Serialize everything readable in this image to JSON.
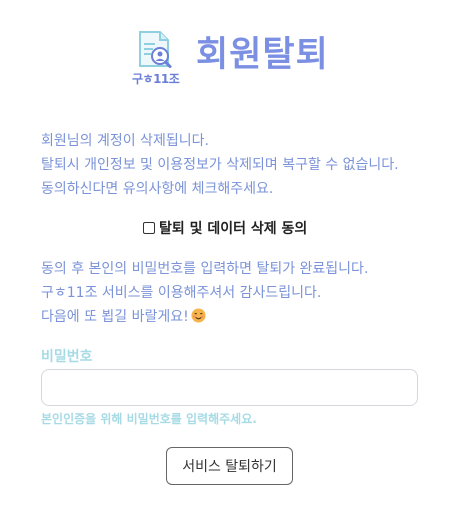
{
  "header": {
    "logo_text": "구ㅎ11조",
    "title": "회원탈퇴"
  },
  "notice_top": {
    "lines": [
      "회원님의 계정이 삭제됩니다.",
      "탈퇴시 개인정보 및 이용정보가 삭제되며 복구할 수 없습니다.",
      "동의하신다면 유의사항에 체크해주세요."
    ]
  },
  "consent": {
    "label": "탈퇴 및 데이터 삭제 동의",
    "checked": false
  },
  "notice_bottom": {
    "lines": [
      "동의 후 본인의 비밀번호를 입력하면 탈퇴가 완료됩니다.",
      "구ㅎ11조 서비스를 이용해주셔서 감사드립니다.",
      "다음에 또 뵙길 바랄게요!"
    ],
    "emoji_icon": "smiling-face-icon"
  },
  "password": {
    "label": "비밀번호",
    "value": "",
    "placeholder": "",
    "help": "본인인증을 위해 비밀번호를 입력해주세요."
  },
  "actions": {
    "withdraw_label": "서비스 탈퇴하기"
  },
  "colors": {
    "title": "#7b8fe3",
    "notice_text": "#7b93d8",
    "password_accent": "#a6dbe6",
    "logo_text": "#6c7fd8"
  }
}
